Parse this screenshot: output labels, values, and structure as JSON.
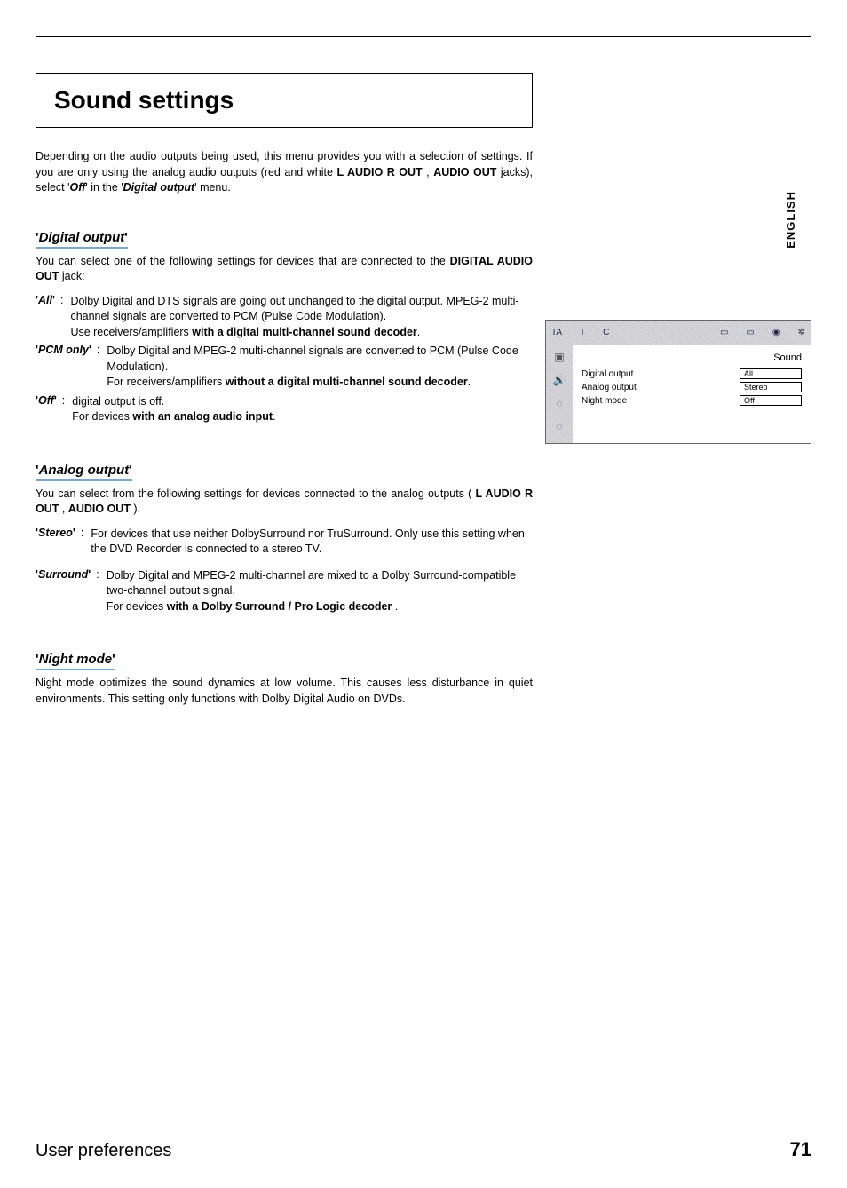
{
  "lang_side": "ENGLISH",
  "title": "Sound settings",
  "intro_1": "Depending on the audio outputs being used, this menu provides you with a selection of settings. If you are only using the analog audio outputs (red and white ",
  "intro_b1": "L AUDIO R OUT",
  "intro_2": " , ",
  "intro_b2": "AUDIO OUT",
  "intro_3": " jacks), select '",
  "intro_bi1": "Off",
  "intro_4": "' in the '",
  "intro_bi2": "Digital output",
  "intro_5": "' menu.",
  "sec1": {
    "heading": "Digital output",
    "body_1": "You can select one of the following settings for devices that are connected to the ",
    "body_b1": "DIGITAL AUDIO OUT",
    "body_2": " jack:",
    "rows": [
      {
        "term": "All",
        "l1": "Dolby Digital and DTS signals are going out unchanged to the digital output. MPEG-2 multi-channel signals are converted to PCM (Pulse Code Modulation).",
        "l2a": "Use receivers/amplifiers ",
        "l2b": "with a digital multi-channel sound decoder",
        "l2c": "."
      },
      {
        "term": "PCM only",
        "l1": "Dolby Digital and MPEG-2 multi-channel signals are converted to PCM (Pulse Code Modulation).",
        "l2a": "For receivers/amplifiers ",
        "l2b": "without a digital multi-channel sound decoder",
        "l2c": "."
      },
      {
        "term": "Off",
        "l1": "digital output is off.",
        "l2a": "For devices ",
        "l2b": "with an analog audio input",
        "l2c": "."
      }
    ]
  },
  "sec2": {
    "heading": "Analog output",
    "body_1": "You can select from the following settings for devices connected to the analog outputs ( ",
    "body_b1": "L AUDIO R OUT",
    "body_2": " , ",
    "body_b2": "AUDIO OUT",
    "body_3": " ).",
    "rows": [
      {
        "term": "Stereo",
        "l1": "For devices that use neither DolbySurround nor TruSurround. Only use this setting when the DVD Recorder is connected to a stereo TV."
      },
      {
        "term": "Surround",
        "l1": "Dolby Digital and MPEG-2 multi-channel are mixed to a Dolby Surround-compatible two-channel output signal.",
        "l2a": "For devices ",
        "l2b": "with a Dolby Surround / Pro Logic decoder",
        "l2c": " ."
      }
    ]
  },
  "sec3": {
    "heading": "Night mode",
    "body": "Night mode optimizes the sound dynamics at low volume. This causes less disturbance in quiet environments. This setting only functions with Dolby Digital Audio on DVDs."
  },
  "osd": {
    "top": [
      "TA",
      "T",
      "C"
    ],
    "title": "Sound",
    "rows": [
      {
        "label": "Digital output",
        "value": "All"
      },
      {
        "label": "Analog output",
        "value": "Stereo"
      },
      {
        "label": "Night mode",
        "value": "Off"
      }
    ]
  },
  "footer": {
    "left": "User preferences",
    "page": "71"
  }
}
